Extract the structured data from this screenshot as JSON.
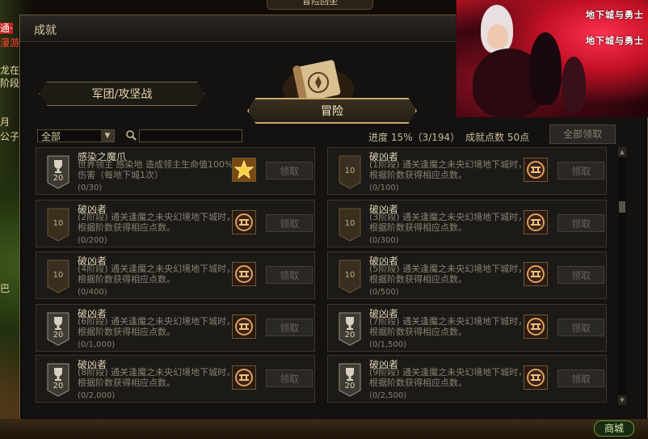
{
  "top": {
    "title": "冒险回坐"
  },
  "left_ui": {
    "l1": "通·",
    "l2": "漫游",
    "l3": "龙在",
    "l4": "阶段",
    "l5": "月",
    "l6": "公子",
    "l7": "巴"
  },
  "window": {
    "title": "成就"
  },
  "banner": {
    "logo1": "地下城与勇士",
    "logo2": "地下城与勇士"
  },
  "tabs": {
    "left": "军团/攻坚战",
    "active": "冒险"
  },
  "filter": {
    "selected": "全部",
    "progress": "进度  15%（3/194）",
    "points": "成就点数 50点",
    "claim_all": "全部领取"
  },
  "cards": [
    {
      "name": "感染之魔爪",
      "desc": "世界领主  感染地      造成领主生命值100%伤害（每地下城1次）",
      "progress": "(0/30)",
      "badge": "20",
      "reward": "star-reward-icon",
      "claim": "领取"
    },
    {
      "name": "破凶者",
      "desc": "(1阶段) 通关逢魔之未央幻境地下城时，根据阶数获得相应点数。",
      "progress": "(0/100)",
      "badge": "10",
      "reward": "emblem-reward-icon",
      "claim": "领取"
    },
    {
      "name": "破凶者",
      "desc": "(2阶段) 通关逢魔之未央幻境地下城时，根据阶数获得相应点数。",
      "progress": "(0/200)",
      "badge": "10",
      "reward": "emblem-reward-icon",
      "claim": "领取"
    },
    {
      "name": "破凶者",
      "desc": "(3阶段) 通关逢魔之未央幻境地下城时，根据阶数获得相应点数。",
      "progress": "(0/300)",
      "badge": "10",
      "reward": "emblem-reward-icon",
      "claim": "领取"
    },
    {
      "name": "破凶者",
      "desc": "(4阶段) 通关逢魔之未央幻境地下城时，根据阶数获得相应点数。",
      "progress": "(0/400)",
      "badge": "10",
      "reward": "emblem-reward-icon",
      "claim": "领取"
    },
    {
      "name": "破凶者",
      "desc": "(5阶段) 通关逢魔之未央幻境地下城时，根据阶数获得相应点数。",
      "progress": "(0/500)",
      "badge": "10",
      "reward": "emblem-reward-icon",
      "claim": "领取"
    },
    {
      "name": "破凶者",
      "desc": "(6阶段) 通关逢魔之未央幻境地下城时，根据阶数获得相应点数。",
      "progress": "(0/1,000)",
      "badge": "20",
      "reward": "emblem-reward-icon",
      "claim": "领取"
    },
    {
      "name": "破凶者",
      "desc": "(7阶段) 通关逢魔之未央幻境地下城时，根据阶数获得相应点数。",
      "progress": "(0/1,500)",
      "badge": "20",
      "reward": "emblem-reward-icon",
      "claim": "领取"
    },
    {
      "name": "破凶者",
      "desc": "(8阶段) 通关逢魔之未央幻境地下城时，根据阶数获得相应点数。",
      "progress": "(0/2,000)",
      "badge": "20",
      "reward": "emblem-reward-icon",
      "claim": "领取"
    },
    {
      "name": "破凶者",
      "desc": "(9阶段) 通关逢魔之未央幻境地下城时，根据阶数获得相应点数。",
      "progress": "(0/2,500)",
      "badge": "20",
      "reward": "emblem-reward-icon",
      "claim": "领取"
    }
  ],
  "bottom": {
    "shop": "商城"
  },
  "colors": {
    "accent": "#c9a86a",
    "banner": "#c21024",
    "panel": "#141210"
  }
}
